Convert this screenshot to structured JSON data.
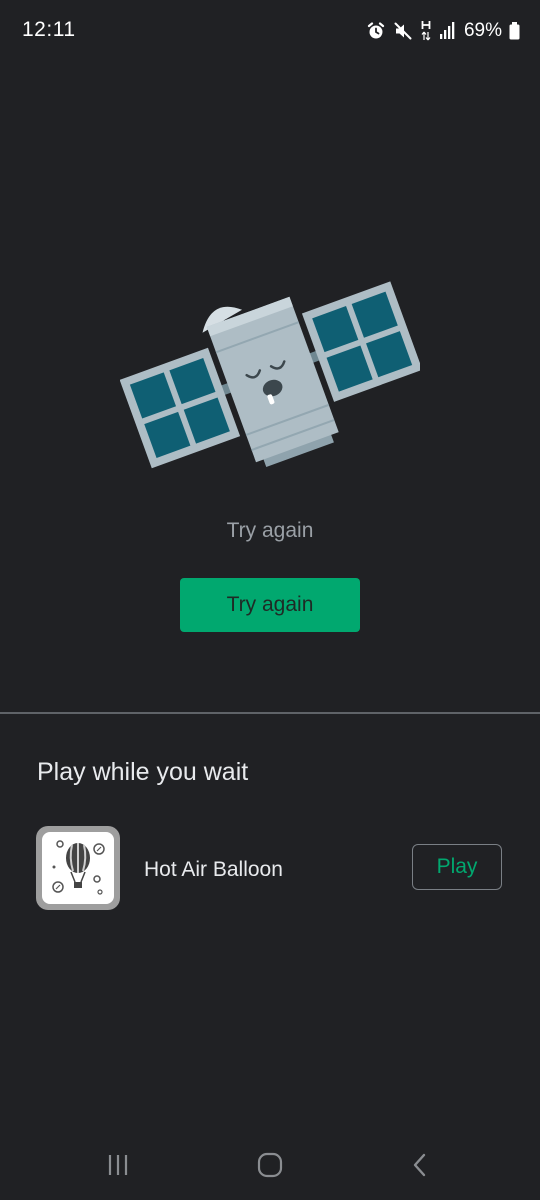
{
  "status_bar": {
    "time": "12:11",
    "battery_percent": "69%",
    "icons": [
      "alarm-icon",
      "mute-icon",
      "hspa-data-icon",
      "signal-icon",
      "battery-icon"
    ]
  },
  "error": {
    "illustration": "sleeping-satellite-illustration",
    "message": "Try again",
    "button_label": "Try again"
  },
  "game_section": {
    "heading": "Play while you wait",
    "games": [
      {
        "title": "Hot Air Balloon",
        "icon": "hot-air-balloon-icon",
        "button_label": "Play"
      }
    ]
  },
  "nav_bar": {
    "buttons": [
      "recent-apps-icon",
      "home-icon",
      "back-icon"
    ]
  },
  "colors": {
    "background": "#202124",
    "accent": "#01a86f",
    "satellite_body": "#aebdc5",
    "solar_panel": "#0f5f73"
  }
}
